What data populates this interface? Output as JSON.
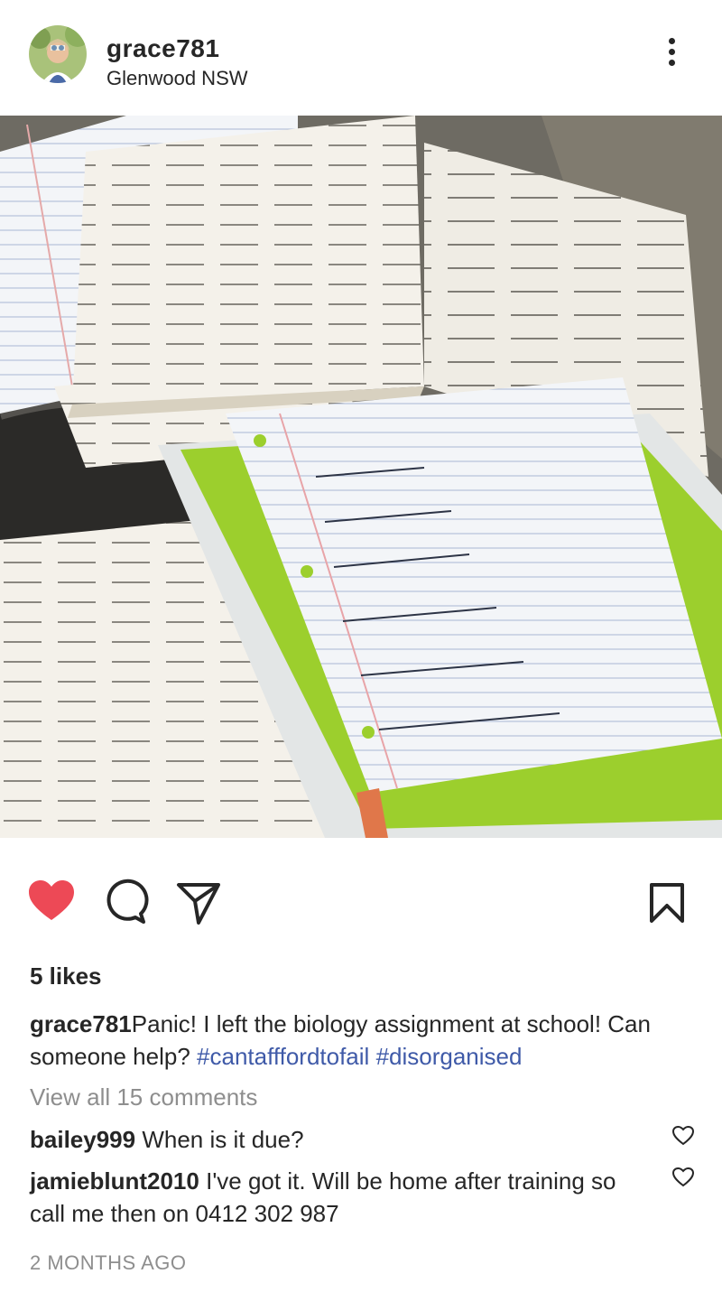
{
  "post": {
    "username": "grace781",
    "location": "Glenwood NSW",
    "likes": "5 likes",
    "caption": {
      "username": "grace781",
      "text": "Panic! I left the biology assignment at school! Can someone help? ",
      "hashtags": [
        "#cantafffordtofail",
        "#disorganised"
      ]
    },
    "view_comments": "View all 15 comments",
    "comments": [
      {
        "username": "bailey999",
        "text": "When is it due?"
      },
      {
        "username": "jamieblunt2010",
        "text": "I've got it. Will be home after training so call me then on 0412 302 987"
      }
    ],
    "timestamp": "2 MONTHS AGO"
  },
  "icons": {
    "avatar": "profile-photo",
    "more": "more-options-icon",
    "like": "heart-filled-icon",
    "comment": "comment-bubble-icon",
    "share": "paper-plane-icon",
    "save": "bookmark-icon",
    "comment_like": "heart-outline-icon"
  },
  "colors": {
    "like_red": "#ed4956",
    "hashtag_blue": "#3f5aa8",
    "muted_gray": "#8e8e8e",
    "text": "#262626"
  }
}
